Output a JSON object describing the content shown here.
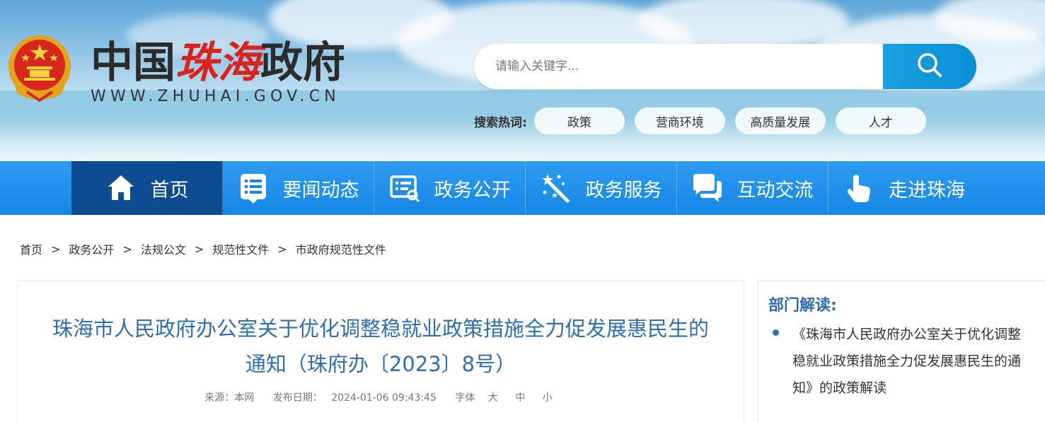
{
  "header": {
    "site_title_black1": "中国",
    "site_title_red": "珠海",
    "site_title_black2": "政府",
    "site_url": "WWW.ZHUHAI.GOV.CN",
    "emblem_icon": "national-emblem-icon"
  },
  "search": {
    "placeholder": "请输入关键字...",
    "button_icon": "search-icon"
  },
  "hotwords": {
    "label": "搜索热词:",
    "items": [
      "政策",
      "营商环境",
      "高质量发展",
      "人才"
    ]
  },
  "nav": {
    "items": [
      {
        "label": "首页",
        "icon": "home-icon"
      },
      {
        "label": "要闻动态",
        "icon": "news-list-icon"
      },
      {
        "label": "政务公开",
        "icon": "document-icon"
      },
      {
        "label": "政务服务",
        "icon": "magic-wand-icon"
      },
      {
        "label": "互动交流",
        "icon": "chat-bubbles-icon"
      },
      {
        "label": "走进珠海",
        "icon": "hand-pointer-icon"
      }
    ],
    "active_color": "#0c4d92",
    "bar_color": "#1586e6"
  },
  "breadcrumb": {
    "items": [
      "首页",
      "政务公开",
      "法规公文",
      "规范性文件",
      "市政府规范性文件"
    ],
    "separator": ">"
  },
  "article": {
    "title_line1": "珠海市人民政府办公室关于优化调整稳就业政策措施全力促发展惠民生的",
    "title_line2": "通知（珠府办〔2023〕8号）",
    "source_label": "来源：本网",
    "date_label": "发布日期：",
    "date_value": "2024-01-06 09:43:45",
    "font_label": "字体",
    "font_large": "大",
    "font_medium": "中",
    "font_small": "小"
  },
  "side": {
    "title": "部门解读:",
    "items": [
      "《珠海市人民政府办公室关于优化调整稳就业政策措施全力促发展惠民生的通知》的政策解读"
    ]
  }
}
